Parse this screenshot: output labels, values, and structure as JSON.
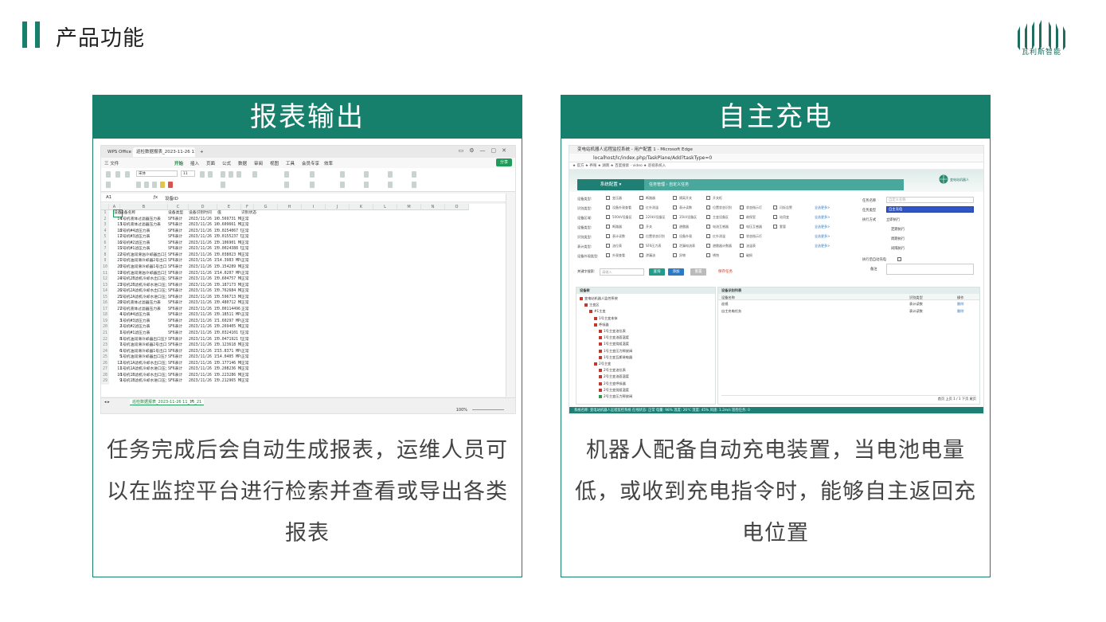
{
  "header": {
    "title": "产品功能",
    "logo_text": "瓦利斯智能"
  },
  "colors": {
    "brand": "#17806d",
    "brand_light": "#4aa79b"
  },
  "cards": [
    {
      "title": "报表输出",
      "desc": "任务完成后会自动生成报表，运维人员可以在监控平台进行检索并查看或导出各类报表"
    },
    {
      "title": "自主充电",
      "desc": "机器人配备自动充电装置，当电池电量低，或收到充电指令时，能够自主返回充电位置"
    }
  ],
  "spreadsheet": {
    "app_tab": "WPS Office",
    "doc_tab": "巡检数据报表_2023-11-26 11:15",
    "menu": [
      "三 文件",
      "开始",
      "插入",
      "页面",
      "公式",
      "数据",
      "审阅",
      "视图",
      "工具",
      "会员专享",
      "效率"
    ],
    "share": "分享",
    "cell_ref": "A1",
    "formula": "设备ID",
    "font_name": "宋体",
    "font_size": "11",
    "columns": [
      "A",
      "B",
      "C",
      "D",
      "E",
      "F",
      "G",
      "H",
      "I",
      "J",
      "K",
      "L",
      "M",
      "N",
      "O"
    ],
    "header_row": [
      "设备ID",
      "设备名称",
      "设备类型",
      "设备识别时间",
      "值",
      "识别状态"
    ],
    "rows": [
      [
        "14",
        "1号机液体过滤器压力表",
        "SF6表计",
        "2023/11/26 16:10",
        "0.569731 MPa",
        "正常"
      ],
      [
        "13",
        "1号机液体过滤器压力表",
        "SF6表计",
        "2023/11/26 16:10",
        "0.609661 MPa",
        "正常"
      ],
      [
        "18",
        "2号机#4滤压力表",
        "SF6表计",
        "2023/11/26 15:57",
        "0.0254067 MPa",
        "正常"
      ],
      [
        "17",
        "2号机#3滤压力表",
        "SF6表计",
        "2023/11/26 15:57",
        "0.0155237 MPa",
        "正常"
      ],
      [
        "16",
        "2号机#2滤压力表",
        "SF6表计",
        "2023/11/26 15:56",
        "0.106901 MPa",
        "正常"
      ],
      [
        "15",
        "2号机#1滤压力表",
        "SF6表计",
        "2023/11/26 15:56",
        "0.0024388 MPa",
        "正常"
      ],
      [
        "22",
        "2号机油润滑油冷却器出口压力表",
        "SF6表计",
        "2023/11/26 15:53",
        "0.038023 MPa",
        "正常"
      ],
      [
        "21",
        "2号机油润滑冷却器2号出口压力表",
        "SF6表计",
        "2023/11/26 15:53",
        "14.3983 MPa",
        "正常"
      ],
      [
        "20",
        "2号机油润滑冷却器1号出口压力表",
        "SF6表计",
        "2023/11/26 15:52",
        "0.154289 MPa",
        "正常"
      ],
      [
        "19",
        "2号机油润滑油冷却器出口压力表",
        "SF6表计",
        "2023/11/26 15:52",
        "14.0207 MPa",
        "正常"
      ],
      [
        "24",
        "2号机2B滤机冷却水出口压力表",
        "SF6表计",
        "2023/11/26 15:50",
        "0.604757 MPa",
        "正常"
      ],
      [
        "23",
        "2号机2B滤机冷却水进口压力表",
        "SF6表计",
        "2023/11/26 15:49",
        "0.187173 MPa",
        "正常"
      ],
      [
        "26",
        "2号机2A滤机冷却水出口压力表",
        "SF6表计",
        "2023/11/26 15:46",
        "0.762684 MPa",
        "正常"
      ],
      [
        "25",
        "2号机2A滤机冷却水进口压力表",
        "SF6表计",
        "2023/11/26 15:45",
        "0.596713 MPa",
        "正常"
      ],
      [
        "28",
        "2号机液体过滤器压力表",
        "SF6表计",
        "2023/11/26 15:40",
        "0.480712 MPa",
        "正常"
      ],
      [
        "27",
        "2号机液体过滤器压力表",
        "SF6表计",
        "2023/11/26 15:40",
        "0.00114496 MPa",
        "正常"
      ],
      [
        "4",
        "1号机#4滤压力表",
        "SF6表计",
        "2023/11/26 15:33",
        "0.18511 MPa",
        "正常"
      ],
      [
        "3",
        "1号机#3滤压力表",
        "SF6表计",
        "2023/11/26 15:32",
        "1.60297 MPa",
        "正常"
      ],
      [
        "2",
        "1号机#2滤压力表",
        "SF6表计",
        "2023/11/26 15:32",
        "0.269405 MPa",
        "正常"
      ],
      [
        "1",
        "1号机#1滤压力表",
        "SF6表计",
        "2023/11/26 15:31",
        "0.0324101 MPa",
        "正常"
      ],
      [
        "8",
        "1号机油润滑冷却器出口压力表",
        "SF6表计",
        "2023/11/26 15:29",
        "0.0471921 MPa",
        "正常"
      ],
      [
        "7",
        "1号机油润滑冷却器2号出口压力表",
        "SF6表计",
        "2023/11/26 15:29",
        "0.123618 MPa",
        "正常"
      ],
      [
        "6",
        "1号机油润滑冷却器1号出口压力表",
        "SF6表计",
        "2023/11/26 15:28",
        "15.8371 MPa",
        "正常"
      ],
      [
        "5",
        "1号机油润滑冷却器出口压力表",
        "SF6表计",
        "2023/11/26 15:27",
        "14.0405 MPa",
        "正常"
      ],
      [
        "12",
        "1号机1A滤机冷却水出口压力表",
        "SF6表计",
        "2023/11/26 15:23",
        "0.177146 MPa",
        "正常"
      ],
      [
        "11",
        "1号机1A滤机冷却水进口压力表",
        "SF6表计",
        "2023/11/26 15:22",
        "0.208236 MPa",
        "正常"
      ],
      [
        "10",
        "1号机1B滤机冷却水出口压力表",
        "SF6表计",
        "2023/11/26 15:20",
        "0.223286 MPa",
        "正常"
      ],
      [
        "9",
        "1号机1B滤机冷却水进口压力表",
        "SF6表计",
        "2023/11/26 15:18",
        "0.212965 MPa",
        "正常"
      ]
    ],
    "sheet_tab": "巡检数据报表_2023-11-26 11_15_21",
    "zoom": "100%"
  },
  "webapp": {
    "window_title": "变电站机器人远程监控系统 - 用户配置 1 - Microsoft Edge",
    "url": "localhost/lc/index.php/TaskPlane/Add?taskType=0",
    "favorites": "★ 官方   ★ 养殖   ★ 湖南   ★ 百度搜索 · video   ★ 巡视系统入",
    "nav_main": "系统配置 ▾",
    "nav_path": "任务管理 › 自定义任务",
    "logo_text": "变电站机器人",
    "form_rows": [
      {
        "label": "设备类型:",
        "items": [
          "变压器",
          "断路器",
          "隔离开关",
          "开关柜"
        ]
      },
      {
        "label": "识别类型:",
        "items": [
          "设备外观查看",
          "红外测温",
          "表计读数",
          "位置状态识别",
          "状态指示灯",
          "闪烁告警"
        ]
      },
      {
        "label": "设备区域:",
        "items": [
          "500kV设备区",
          "220kV设备区",
          "35kV设备区",
          "主变设备区",
          "继保室",
          "站用变"
        ]
      },
      {
        "label": "设备类型:",
        "items": [
          "断路器",
          "开关",
          "避雷器",
          "电流互感器",
          "电压互感器",
          "套管"
        ]
      },
      {
        "label": "识别类型:",
        "items": [
          "表计读数",
          "位置状态识别",
          "设备外观",
          "红外测温",
          "状态指示灯"
        ]
      },
      {
        "label": "表计类型:",
        "items": [
          "油位表",
          "SF6压力表",
          "泄漏电流表",
          "避雷器计数器",
          "油温表"
        ]
      },
      {
        "label": "设备外观类型:",
        "items": [
          "外观查看",
          "渗漏油",
          "异物",
          "锈蚀",
          "破损"
        ]
      }
    ],
    "select_all": "全选更多>",
    "right_form": {
      "task_name_label": "任务名称",
      "task_name_ph": "自定义名称",
      "task_type_label": "任务类型",
      "task_type_value": "自主充电",
      "exec_label": "执行方式",
      "exec_opt1": "立即执行",
      "exec_opt2": "定期执行",
      "exec_opt3": "周期执行",
      "exec_opt4": "间隔执行",
      "charge_label": "执行后自动充电",
      "remark_label": "备注"
    },
    "search_label": "关键字搜索:",
    "search_ph": "请输入",
    "btn_search": "查询",
    "btn_add": "添加",
    "btn_reset": "重置",
    "btn_save": "保存任务",
    "tree_title": "设备树",
    "tree_nodes": [
      "变电站机器人监控系统",
      "主变区",
      "#1主变",
      "1号主变本体",
      "呼吸器",
      "1号主变油位表",
      "1号主变油面温度",
      "1号主变绕组温度",
      "1号主变压力释放阀",
      "1号主变瓦斯继电器",
      "2号主变",
      "2号主变油位表",
      "2号主变油面温度",
      "2号主变呼吸器",
      "2号主变绕组温度",
      "2号主变压力释放阀"
    ],
    "table_title": "设备识别列表",
    "table_cols": [
      "设备名称",
      "识别类型",
      "操作"
    ],
    "table_rows": [
      [
        "巡视",
        "表计读数",
        "删除"
      ],
      [
        "自主充电任务",
        "表计读数",
        "删除"
      ]
    ],
    "pager": "首页 上页 1 / 1 下页 尾页",
    "footer": "系统名称: 变电站机器人远程监控系统   在线状态: 正常   电量: 98%   温度: 26℃   湿度: 45%   风速: 1.2m/s   巡检任务: 0"
  }
}
